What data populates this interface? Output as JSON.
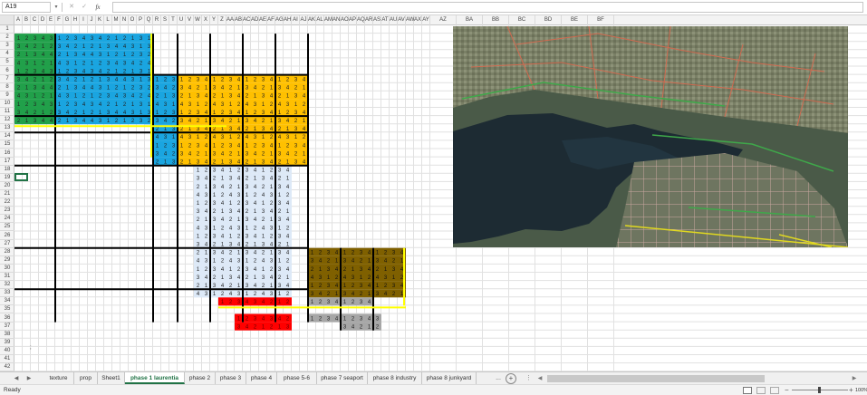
{
  "formula_bar": {
    "name_box": "A19",
    "dropdown_icon": "chevron-down-icon",
    "cancel_glyph": "✕",
    "enter_glyph": "✓",
    "fx_label": "fx",
    "formula": ""
  },
  "columns": [
    "A",
    "B",
    "C",
    "D",
    "E",
    "F",
    "G",
    "H",
    "I",
    "J",
    "K",
    "L",
    "M",
    "N",
    "O",
    "P",
    "Q",
    "R",
    "S",
    "T",
    "U",
    "V",
    "W",
    "X",
    "Y",
    "Z",
    "AA",
    "AB",
    "AC",
    "AD",
    "AE",
    "AF",
    "AG",
    "AH",
    "AI",
    "AJ",
    "AK",
    "AL",
    "AM",
    "AN",
    "AO",
    "AP",
    "AQ",
    "AR",
    "AS",
    "AT",
    "AU",
    "AV",
    "AW",
    "AX",
    "AY",
    "AZ",
    "BA",
    "BB",
    "BC",
    "BD",
    "BE",
    "BF"
  ],
  "rows": [
    "1",
    "2",
    "3",
    "4",
    "5",
    "6",
    "7",
    "8",
    "9",
    "10",
    "11",
    "12",
    "13",
    "14",
    "15",
    "16",
    "17",
    "18",
    "19",
    "20",
    "21",
    "22",
    "23",
    "24",
    "25",
    "26",
    "27",
    "28",
    "29",
    "30",
    "31",
    "32",
    "33",
    "34",
    "35",
    "36",
    "37",
    "38",
    "39",
    "40",
    "41",
    "42"
  ],
  "colors": {
    "green": "#21a04a",
    "blue": "#1aa5e0",
    "orange": "#ffc000",
    "lightblue": "#dde9f7",
    "brown": "#7f6000",
    "gray": "#a6a6a6",
    "red": "#ff0000",
    "yellow_line": "#ffff00",
    "excel_green": "#217346"
  },
  "cell_note": ";",
  "sheet_tabs": [
    "texture",
    "prop",
    "Sheet1",
    "phase 1 laurentia",
    "phase 2",
    "phase 3",
    "phase 4",
    "phase 5-6",
    "phase 7 seaport",
    "phase 8 industry",
    "phase 8 junkyard"
  ],
  "active_tab": "phase 1 laurentia",
  "tabs_more": "...",
  "add_sheet_glyph": "+",
  "nav_prev": "◀",
  "nav_next": "▶",
  "status": "Ready",
  "zoom": "100%",
  "map_alt": "city-map-screenshot"
}
